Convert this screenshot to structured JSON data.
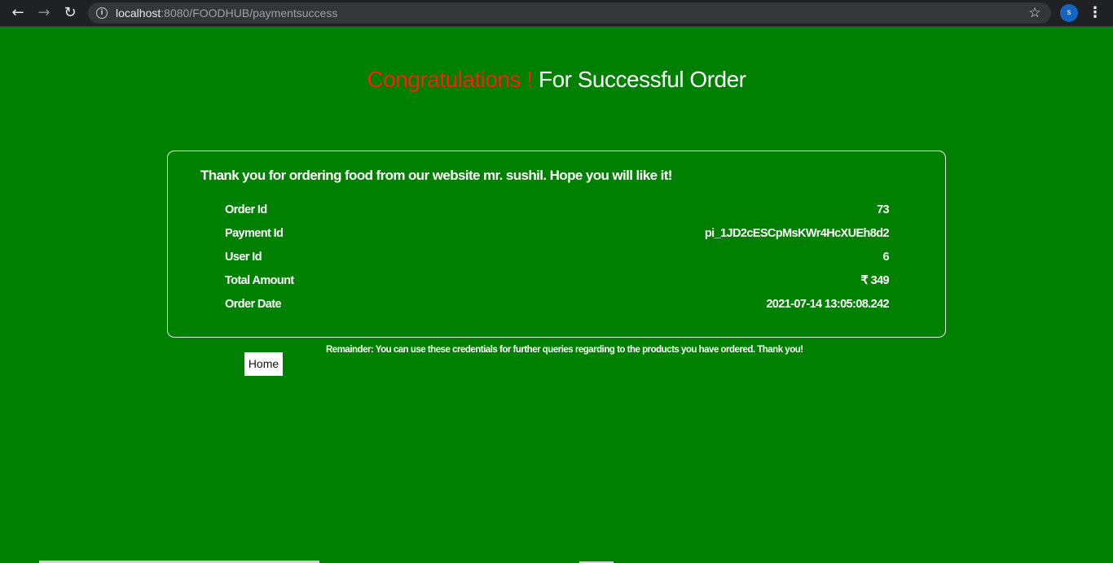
{
  "browser": {
    "back_icon": "←",
    "forward_icon": "→",
    "reload_icon": "↻",
    "info_icon": "i",
    "url_host": "localhost",
    "url_rest": ":8080/FOODHUB/paymentsuccess",
    "star_icon": "☆",
    "avatar_letter": "s",
    "menu_icon": "⋮"
  },
  "page": {
    "heading_congrats": "Congratulations !",
    "heading_rest": " For Successful Order",
    "thanks_message": "Thank you for ordering food from our website mr. sushil. Hope you will like it!",
    "details": [
      {
        "label": "Order Id",
        "value": "73"
      },
      {
        "label": "Payment Id",
        "value": "pi_1JD2cESCpMsKWr4HcXUEh8d2"
      },
      {
        "label": "User Id",
        "value": "6"
      },
      {
        "label": "Total Amount",
        "value": "₹ 349"
      },
      {
        "label": "Order Date",
        "value": "2021-07-14 13:05:08.242"
      }
    ],
    "reminder": "Remainder: You can use these credentials for further queries regarding to the products you have ordered. Thank you!",
    "home_button": "Home"
  },
  "colors": {
    "background": "#008000",
    "congrats": "#ff1a1a",
    "text": "#ffffff"
  }
}
